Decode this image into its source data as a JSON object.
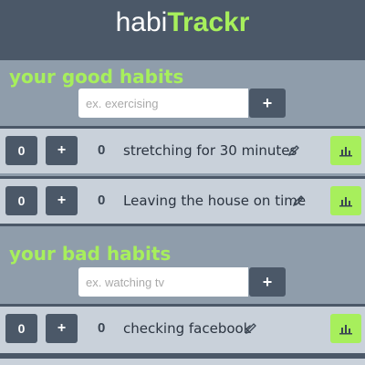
{
  "app": {
    "title_part1": "habi",
    "title_part2": "Trackr"
  },
  "good_habits": {
    "title": "your good habits",
    "placeholder": "ex. exercising",
    "add_label": "+",
    "items": [
      {
        "count": "0",
        "plus": "+",
        "total": "0",
        "name": "stretching for 30 minutes"
      },
      {
        "count": "0",
        "plus": "+",
        "total": "0",
        "name": "Leaving the house on time"
      }
    ]
  },
  "bad_habits": {
    "title": "your bad habits",
    "placeholder": "ex. watching tv",
    "add_label": "+",
    "items": [
      {
        "count": "0",
        "plus": "+",
        "total": "0",
        "name": "checking facebook"
      }
    ]
  },
  "colors": {
    "accent": "#a7ef5c",
    "dark": "#4b5868",
    "panel": "#8f9dab",
    "row": "#c9d1da"
  },
  "icons": {
    "edit": "pencil-icon",
    "stats": "bar-chart-icon"
  }
}
